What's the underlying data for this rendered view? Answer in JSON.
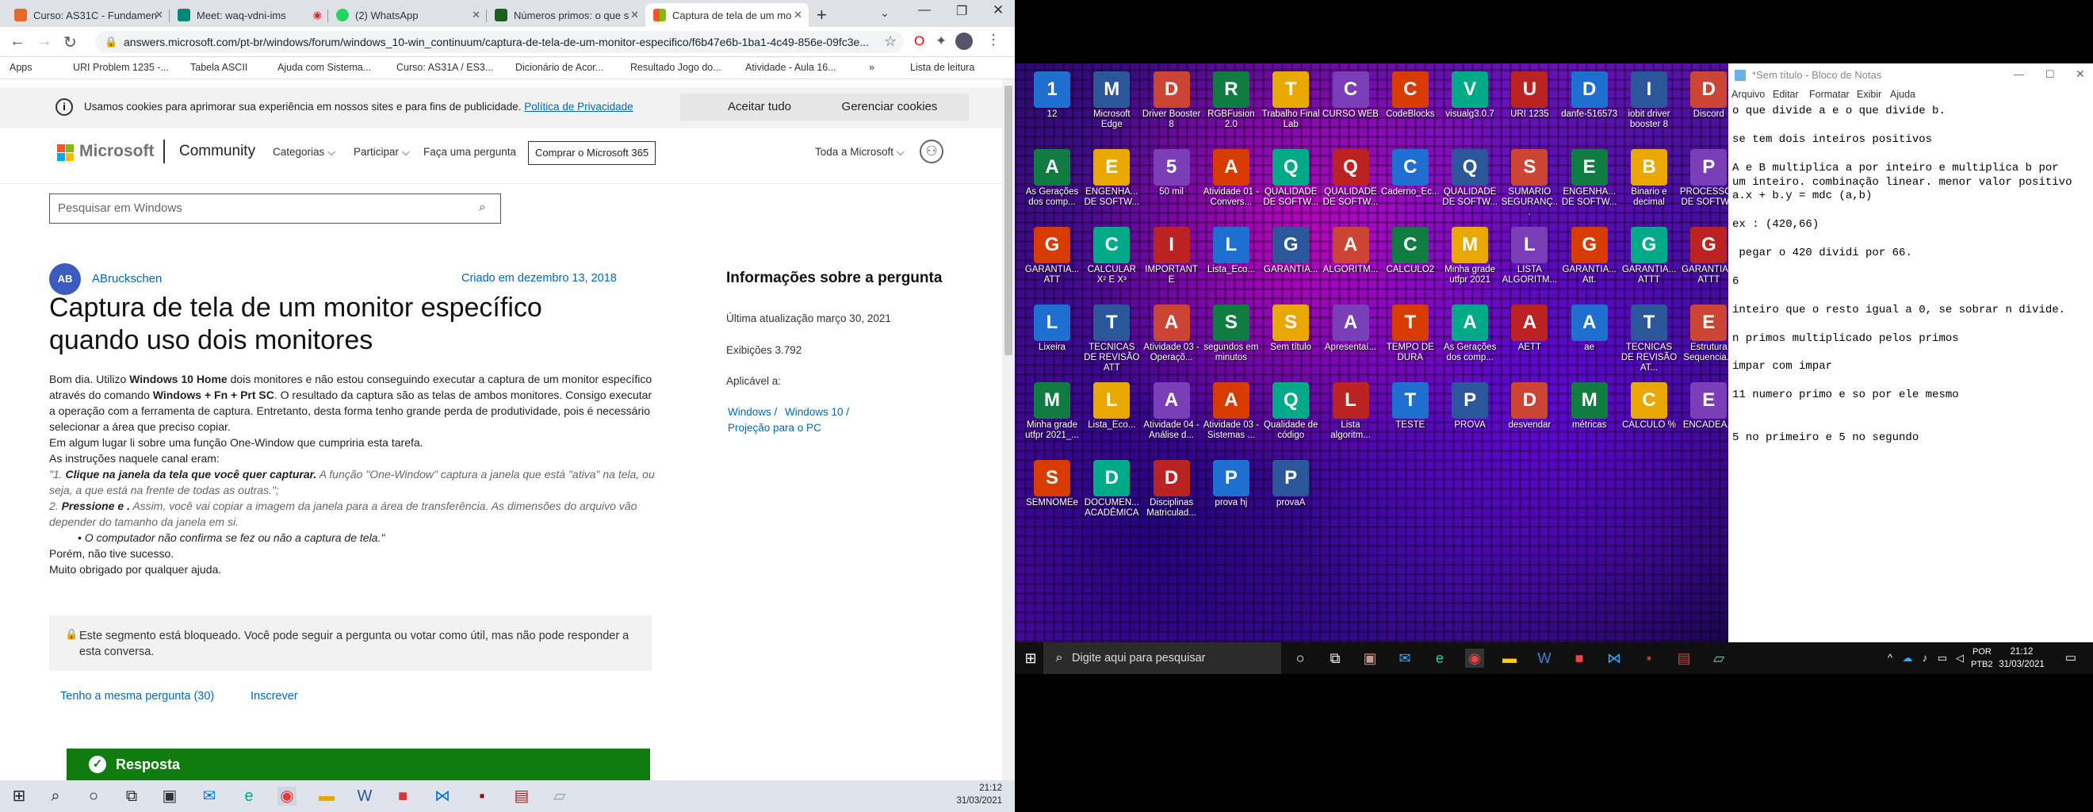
{
  "browser": {
    "tabs": [
      {
        "label": "Curso: AS31C - Fundamen",
        "color": "#e36b26"
      },
      {
        "label": "Meet: waq-vdni-ims",
        "color": "#00897b"
      },
      {
        "label": "(2) WhatsApp",
        "color": "#25d366"
      },
      {
        "label": "Números primos: o que s",
        "color": "#1b5e20"
      },
      {
        "label": "Captura de tela de um mo",
        "color": "#f35325"
      }
    ],
    "new_tab": "+",
    "url": "answers.microsoft.com/pt-br/windows/forum/windows_10-win_continuum/captura-de-tela-de-um-monitor-especifico/f6b47e6b-1ba1-4c49-856e-09fc3e...",
    "bookmarks": [
      "Apps",
      "URI Problem 1235 -...",
      "Tabela ASCII",
      "Ajuda com Sistema...",
      "Curso: AS31A / ES3...",
      "Dicionário de Acor...",
      "Resultado Jogo do...",
      "Atividade - Aula 16...",
      "»",
      "Lista de leitura"
    ]
  },
  "page": {
    "cookie_text": "Usamos cookies para aprimorar sua experiência em nossos sites e para fins de publicidade.",
    "cookie_link": "Política de Privacidade",
    "accept": "Aceitar tudo",
    "manage": "Gerenciar cookies",
    "brand": "Microsoft",
    "community": "Community",
    "nav": [
      "Categorias ⌵",
      "Participar ⌵",
      "Faça uma pergunta"
    ],
    "buy": "Comprar o Microsoft 365",
    "all_ms": "Toda a Microsoft ⌵",
    "search_placeholder": "Pesquisar em Windows",
    "avatar_initials": "AB",
    "author": "ABruckschen",
    "created": "Criado em dezembro 13, 2018",
    "title": "Captura de tela de um monitor específico quando uso dois monitores",
    "p1a": "Bom dia. Utilizo ",
    "p1b": "Windows 10 Home",
    "p1c": " dois monitores e não estou conseguindo executar a captura de um monitor específico através do comando ",
    "p1d": "Windows + Fn + Prt SC",
    "p1e": ". O resultado da captura são as telas de ambos monitores. Consigo executar a operação com a ferramenta de captura. Entretanto, desta forma tenho grande perda de produtividade, pois é necessário selecionar a área que preciso copiar.",
    "p2": "Em algum lugar li sobre uma função One-Window que cumpriria esta tarefa.",
    "p3": "As instruções naquele canal eram:",
    "q1a": "\"1. ",
    "q1b": "Clique na janela da tela que você quer capturar.",
    "q1c": " A função \"One-Window\" captura a janela que está \"ativa\" na tela, ou seja, a que está na frente de todas as outras.\";",
    "q2a": "2. ",
    "q2b": "Pressione  e .",
    "q2c": " Assim, você vai copiar a imagem da janela para a área de transferência. As dimensões do arquivo vão depender do tamanho da janela em si.",
    "bullet": "O computador não confirma se fez ou não a captura de tela.\"",
    "p4": "Porém, não tive sucesso.",
    "p5": "Muito obrigado por qualquer ajuda.",
    "locked": "Este segmento está bloqueado. Você pode seguir a pergunta ou votar como útil, mas não pode responder a esta conversa.",
    "same_question": "Tenho a mesma pergunta (30)",
    "subscribe": "Inscrever",
    "answer": "Resposta",
    "info_title": "Informações sobre a pergunta",
    "last_update": "Última atualização março 30, 2021",
    "views": "Exibições 3.792",
    "applies": "Aplicável a:",
    "applies_links": [
      "Windows /",
      "Windows 10 /",
      "Projeção para o PC"
    ]
  },
  "taskbar_left": {
    "time": "21:12",
    "date": "31/03/2021"
  },
  "desktop": {
    "icons": [
      [
        "12",
        "Microsoft Edge",
        "Driver Booster 8",
        "RGBFusion 2.0",
        "Trabalho Final Lab",
        "CURSO WEB",
        "CodeBlocks",
        "visualg3.0.7",
        "URI 1235",
        "danfe-516573",
        "iobit driver booster 8",
        "Discord"
      ],
      [
        "As Gerações dos comp...",
        "ENGENHA... DE SOFTW...",
        "50 mil",
        "Atividade 01 - Convers...",
        "QUALIDADE DE SOFTW...",
        "QUALIDADE DE SOFTW...",
        "Caderno_Ec...",
        "QUALIDADE DE SOFTW...",
        "SUMARIO SEGURANÇ...",
        "ENGENHA... DE SOFTW...",
        "Binario e decimal",
        "PROCESSOS DE SOFTW..."
      ],
      [
        "GARANTIA... ATT",
        "CALCULAR X² E X³",
        "IMPORTANTE",
        "Lista_Eco...",
        "GARANTIA...",
        "ALGORITM...",
        "CALCULO2",
        "Minha grade utfpr 2021",
        "LISTA ALGORITM...",
        "GARANTIA... Att.",
        "GARANTIA... ATTT",
        "GARANTIA... ATTT"
      ],
      [
        "Lixeira",
        "TECNICAS DE REVISÃO ATT",
        "Atividade 03 - Operaçõ...",
        "segundos em minutos",
        "Sem título",
        "Apresentaí...",
        "TEMPO DE DURA",
        "As Gerações dos comp...",
        "AETT",
        "ae",
        "TECNICAS DE REVISÃO AT...",
        "Estrutura Sequencia..."
      ],
      [
        "Minha grade utfpr 2021_...",
        "Lista_Eco...",
        "Atividade 04 - Análise d...",
        "Atividade 03 - Sistemas ...",
        "Qualidade de código",
        "Lista algoritm...",
        "TESTE",
        "PROVA",
        "desvendar",
        "métricas",
        "CALCULO %",
        "ENCADEA..."
      ],
      [
        "SEMNOMEe",
        "DOCUMEN... ACADÊMICA",
        "Disciplinas Matriculad...",
        "prova hj",
        "provaA"
      ]
    ]
  },
  "notepad": {
    "title": "*Sem título - Bloco de Notas",
    "menu": [
      "Arquivo",
      "Editar",
      "Formatar",
      "Exibir",
      "Ajuda"
    ],
    "text": "o que divide a e o que divide b.\n\nse tem dois inteiros positivos\n\nA e B multiplica a por inteiro e multiplica b por\num inteiro. combinação linear. menor valor positivo\na.x + b.y = mdc (a,b)\n\nex : (420,66)\n\n pegar o 420 dividi por 66.\n\n6\n\ninteiro que o resto igual a 0, se sobrar n divide.\n\nn primos multiplicado pelos primos\n\nimpar com impar\n\n11 numero primo e so por ele mesmo\n\n\n5 no primeiro e 5 no segundo"
  },
  "taskbar_right": {
    "search_placeholder": "Digite aqui para pesquisar",
    "lang1": "POR",
    "lang2": "PTB2",
    "time": "21:12",
    "date": "31/03/2021"
  }
}
